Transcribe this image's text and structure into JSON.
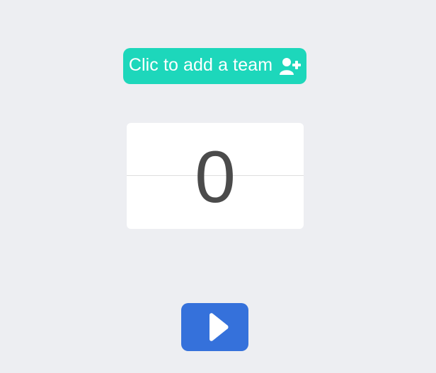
{
  "colors": {
    "background": "#edeef2",
    "add_team_button": "#1dd7bb",
    "score_card": "#ffffff",
    "score_text": "#4b4b4b",
    "play_button": "#3571db",
    "icon": "#ffffff"
  },
  "add_team": {
    "label": "Clic to add a team",
    "icon": "user-plus-icon"
  },
  "score": {
    "value": "0"
  },
  "play": {
    "icon": "play-icon"
  }
}
